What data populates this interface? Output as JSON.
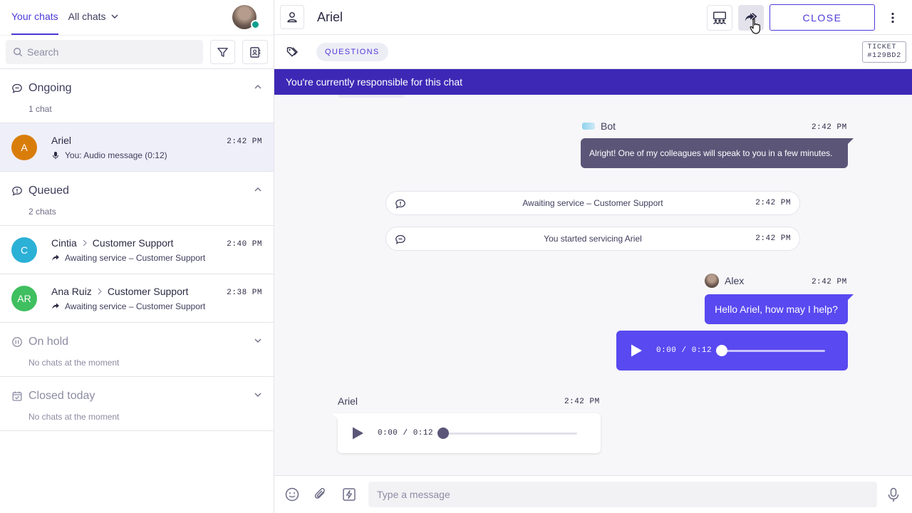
{
  "sidebar": {
    "tabs": [
      {
        "label": "Your chats",
        "active": true
      },
      {
        "label": "All chats",
        "active": false
      }
    ],
    "search_placeholder": "Search",
    "sections": {
      "ongoing": {
        "title": "Ongoing",
        "count": "1 chat",
        "expanded": true
      },
      "queued": {
        "title": "Queued",
        "count": "2 chats",
        "expanded": true
      },
      "on_hold": {
        "title": "On hold",
        "count": "No chats at the moment",
        "expanded": false
      },
      "closed_today": {
        "title": "Closed today",
        "count": "No chats at the moment",
        "expanded": false
      }
    },
    "ongoing_chats": [
      {
        "initials": "A",
        "name": "Ariel",
        "preview": "You: Audio message (0:12)",
        "time": "2:42 PM",
        "avatar_color": "#d97d0a"
      }
    ],
    "queued_chats": [
      {
        "initials": "C",
        "name": "Cintia",
        "team": "Customer Support",
        "preview": "Awaiting service – Customer Support",
        "time": "2:40 PM",
        "avatar_color": "#2bb0d6"
      },
      {
        "initials": "AR",
        "name": "Ana Ruiz",
        "team": "Customer Support",
        "preview": "Awaiting service – Customer Support",
        "time": "2:38 PM",
        "avatar_color": "#3fbf5f"
      }
    ]
  },
  "header": {
    "contact_name": "Ariel",
    "close_label": "CLOSE",
    "tag": "QUESTIONS",
    "ticket_label": "TICKET",
    "ticket_id": "#129BD2"
  },
  "banner": "You're currently responsible for this chat",
  "messages": {
    "bot": {
      "sender": "Bot",
      "time": "2:42 PM",
      "text": "Alright! One of my colleagues will speak to you in a few minutes."
    },
    "system": [
      {
        "text": "Awaiting service – Customer Support",
        "time": "2:42 PM",
        "icon": "chat-alert-icon"
      },
      {
        "text": "You started servicing Ariel",
        "time": "2:42 PM",
        "icon": "chat-bubble-icon"
      }
    ],
    "agent": {
      "sender": "Alex",
      "time": "2:42 PM",
      "text": "Hello Ariel, how may I help?",
      "audio_time": "0:00 / 0:12",
      "audio_progress": 0
    },
    "customer": {
      "sender": "Ariel",
      "time": "2:42 PM",
      "audio_time": "0:00 / 0:12",
      "audio_progress": 0
    }
  },
  "composer": {
    "placeholder": "Type a message"
  },
  "colors": {
    "accent": "#4b3ad9",
    "banner": "#3d28b6",
    "agent_bubble": "#5949f0",
    "bot_bubble": "#5b5678"
  }
}
